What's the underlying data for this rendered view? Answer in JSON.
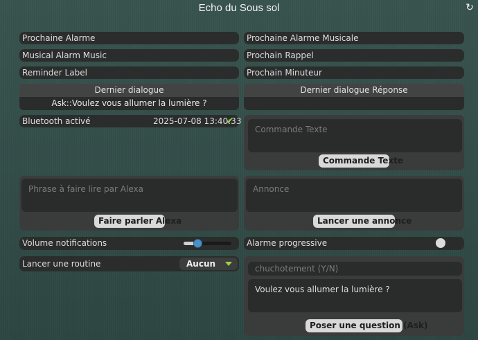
{
  "window": {
    "title": "Echo du Sous sol"
  },
  "fields": {
    "next_alarm": "Prochaine Alarme",
    "next_music_alarm": "Prochaine Alarme Musicale",
    "music_alarm": "Musical Alarm Music",
    "next_reminder": "Prochain Rappel",
    "reminder_label": "Reminder Label",
    "next_timer": "Prochain Minuteur"
  },
  "dialog": {
    "last_label": "Dernier dialogue",
    "last_value": "Ask::Voulez vous allumer la lumière ?",
    "reply_label": "Dernier dialogue Réponse",
    "reply_value": ""
  },
  "bluetooth": {
    "label": "Bluetooth activé",
    "timestamp": "2025-07-08 13:40:33",
    "status_icon": "check-icon",
    "status_color": "#8fd14f"
  },
  "text_command": {
    "placeholder": "Commande Texte",
    "button": "Commande Texte"
  },
  "speak": {
    "placeholder": "Phrase à faire lire par Alexa",
    "button": "Faire parler Alexa"
  },
  "announce": {
    "placeholder": "Annonce",
    "button": "Lancer une annonce"
  },
  "volume": {
    "label": "Volume notifications",
    "level": 0.3
  },
  "progressive_alarm": {
    "label": "Alarme progressive",
    "enabled": false
  },
  "routine": {
    "label": "Lancer une routine",
    "selected": "Aucun"
  },
  "ask": {
    "whisper_placeholder": "chuchotement (Y/N)",
    "question_value": "Voulez vous allumer la lumière ?",
    "button": "Poser une question (Ask)"
  }
}
